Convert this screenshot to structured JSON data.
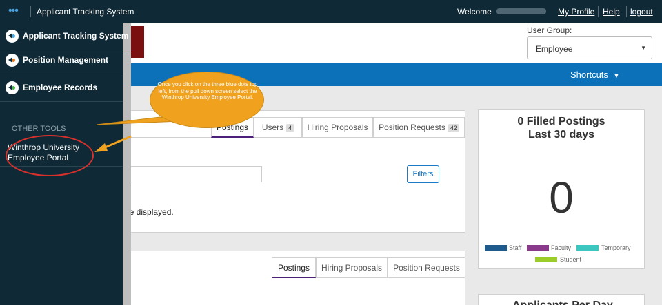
{
  "topbar": {
    "app_title": "Applicant Tracking System",
    "welcome": "Welcome",
    "my_profile": "My Profile",
    "help": "Help",
    "logout": "logout"
  },
  "header": {
    "user_group_label": "User Group:",
    "user_group_value": "Employee"
  },
  "nav": {
    "shortcuts": "Shortcuts"
  },
  "sidebar": {
    "items": [
      {
        "label": "Applicant Tracking System",
        "dot_color": "#4aa3df"
      },
      {
        "label": "Position Management",
        "dot_color": "#e8791c"
      },
      {
        "label": "Employee Records",
        "dot_color": "#4ab04a"
      }
    ],
    "other_tools_label": "OTHER TOOLS",
    "portal_link_line1": "Winthrop University",
    "portal_link_line2": "Employee Portal"
  },
  "panel1": {
    "tabs": [
      {
        "label": "Postings",
        "badge": ""
      },
      {
        "label": "Users",
        "badge": "4"
      },
      {
        "label": "Hiring Proposals",
        "badge": ""
      },
      {
        "label": "Position Requests",
        "badge": "42"
      }
    ],
    "filters_label": "Filters",
    "empty_text": "be displayed."
  },
  "panel2": {
    "tabs": [
      {
        "label": "Postings"
      },
      {
        "label": "Hiring Proposals"
      },
      {
        "label": "Position Requests"
      }
    ]
  },
  "stats": {
    "title_line1": "0 Filled Postings",
    "title_line2": "Last 30 days",
    "value": "0",
    "legend": [
      {
        "label": "Staff",
        "color": "#1e5a8c"
      },
      {
        "label": "Faculty",
        "color": "#8a3a8a"
      },
      {
        "label": "Temporary",
        "color": "#3cc6c0"
      },
      {
        "label": "Student",
        "color": "#9ccc2a"
      }
    ]
  },
  "applicants_title": "Applicants Per Day",
  "annotation": {
    "callout": "Once you click on the three blue dots top left, from the pull down screen select the Winthrop University Employee Portal."
  }
}
